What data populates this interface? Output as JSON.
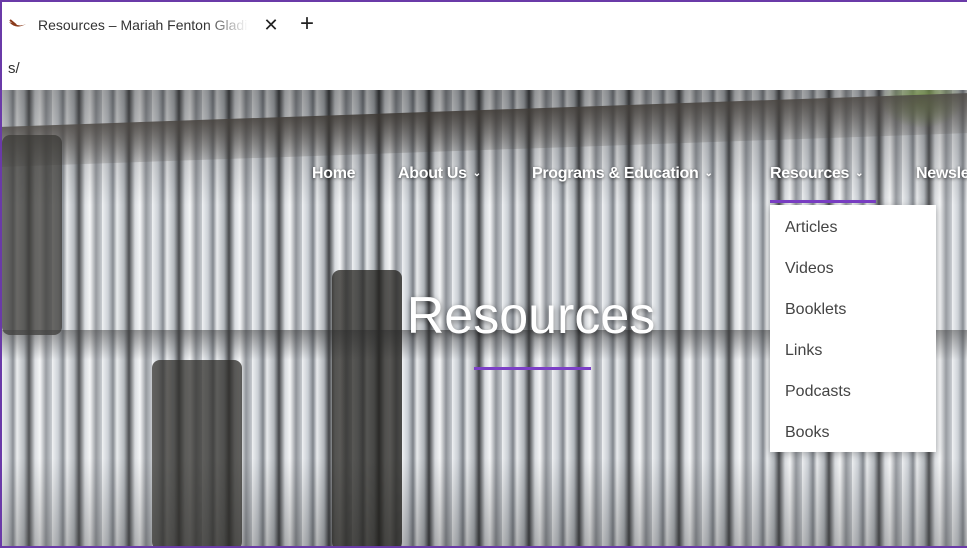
{
  "browser": {
    "tab_title": "Resources – Mariah Fenton Gladis",
    "tab_close": "✕",
    "new_tab": "+",
    "url": "s/"
  },
  "nav": {
    "items": [
      {
        "label": "Home"
      },
      {
        "label": "About Us"
      },
      {
        "label": "Programs & Education"
      },
      {
        "label": "Resources"
      },
      {
        "label": "Newsletter"
      }
    ],
    "chevron": "⌄"
  },
  "page": {
    "title": "Resources",
    "accent_color": "#7b3fc6"
  },
  "dropdown": {
    "items": [
      "Articles",
      "Videos",
      "Booklets",
      "Links",
      "Podcasts",
      "Books"
    ]
  }
}
